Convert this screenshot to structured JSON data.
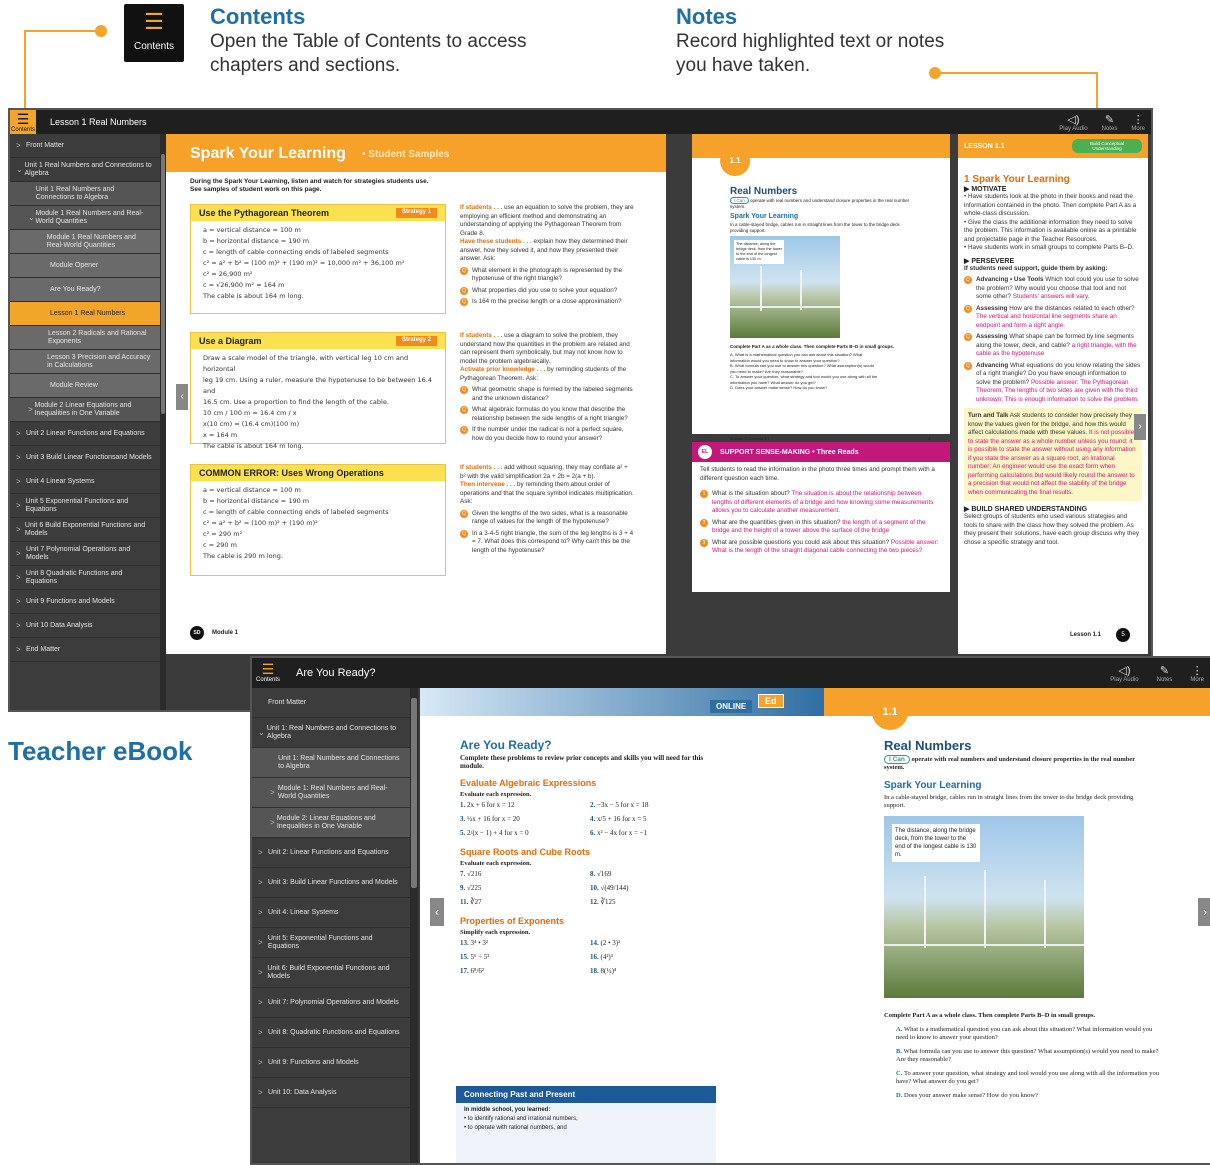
{
  "callouts": {
    "contents": {
      "title": "Contents",
      "text": "Open the Table of Contents to access chapters and sections.",
      "icon_label": "Contents"
    },
    "notes": {
      "title": "Notes",
      "text": "Record highlighted text or notes you have taken."
    },
    "teacher_ebook": "Teacher eBook"
  },
  "colors": {
    "accent": "#f3a52a",
    "callout_blue": "#1d6fa5",
    "sidebar": "#3c3c3c",
    "topbar": "#1f1f1f"
  },
  "teacher": {
    "menu_label": "Contents",
    "title": "Lesson 1 Real Numbers",
    "toolbar": {
      "play": "Play Audio",
      "notes": "Notes",
      "more": "More"
    },
    "sidebar": [
      {
        "label": "Front Matter",
        "level": 0,
        "chev": ">"
      },
      {
        "label": "Unit 1 Real Numbers and Connections to Algebra",
        "level": 0,
        "chev": "v"
      },
      {
        "label": "Unit 1 Real Numbers and Connections to Algebra",
        "level": 1,
        "chev": ""
      },
      {
        "label": "Module 1 Real Numbers and Real-World Quantities",
        "level": 1,
        "chev": "v"
      },
      {
        "label": "Module 1 Real Numbers and Real-World Quantities",
        "level": 2,
        "chev": ""
      },
      {
        "label": "Module Opener",
        "level": 2,
        "chev": ""
      },
      {
        "label": "Are You Ready?",
        "level": 2,
        "chev": ""
      },
      {
        "label": "Lesson 1 Real Numbers",
        "level": 2,
        "chev": "",
        "active": true
      },
      {
        "label": "Lesson 2 Radicals and Rational Exponents",
        "level": 2,
        "chev": ""
      },
      {
        "label": "Lesson 3 Precision and Accuracy in Calculations",
        "level": 2,
        "chev": ""
      },
      {
        "label": "Module Review",
        "level": 2,
        "chev": ""
      },
      {
        "label": "Module 2 Linear Equations and Inequalities in One Variable",
        "level": 1,
        "chev": ">"
      },
      {
        "label": "Unit 2 Linear Functions and Equations",
        "level": 0,
        "chev": ">"
      },
      {
        "label": "Unit 3 Build Linear Functionsand Models",
        "level": 0,
        "chev": ">"
      },
      {
        "label": "Unit 4 Linear Systems",
        "level": 0,
        "chev": ">"
      },
      {
        "label": "Unit 5 Exponential Functions and Equations",
        "level": 0,
        "chev": ">"
      },
      {
        "label": "Unit 6 Build Exponential Functions and Models",
        "level": 0,
        "chev": ">"
      },
      {
        "label": "Unit 7 Polynomial Operations and Models",
        "level": 0,
        "chev": ">"
      },
      {
        "label": "Unit 8 Quadratic Functions and Equations",
        "level": 0,
        "chev": ">"
      },
      {
        "label": "Unit 9 Functions and Models",
        "level": 0,
        "chev": ">"
      },
      {
        "label": "Unit 10 Data Analysis",
        "level": 0,
        "chev": ">"
      },
      {
        "label": "End Matter",
        "level": 0,
        "chev": ">"
      }
    ],
    "left_page": {
      "banner": "Spark Your Learning",
      "banner_sub": "• Student Samples",
      "intro": "During the Spark Your Learning, listen and watch for strategies students use. See samples of student work on this page.",
      "box1": {
        "title": "Use the Pythagorean Theorem",
        "tag": "Strategy 1",
        "lines": [
          "a = vertical distance = 100 m",
          "b = horizontal distance = 190 m",
          "c = length of cable connecting ends of labeled segments",
          "c² = a² + b² = (100 m)² + (190 m)² = 10,000 m² + 36,100 m²",
          "c² = 26,900 m²",
          "c = √26,900 m² ≈ 164 m",
          "The cable is about 164 m long."
        ]
      },
      "box2": {
        "title": "Use a Diagram",
        "tag": "Strategy 2",
        "lines": [
          "Draw a scale model of the triangle, with vertical leg 10 cm and horizontal",
          "leg 19 cm. Using a ruler, measure the hypotenuse to be between 16.4 and",
          "16.5 cm. Use a proportion to find the length of the cable.",
          "10 cm / 100 m = 16.4 cm / x",
          "x(10 cm) = (16.4 cm)(100 m)",
          "x = 164 m",
          "The cable is about 164 m long."
        ]
      },
      "box3": {
        "title": "COMMON ERROR: Uses Wrong Operations",
        "lines": [
          "a = vertical distance = 100 m",
          "b = horizontal distance = 190 m",
          "c = length of cable connecting ends of labeled segments",
          "c² = a² + b² = (100 m)² + (190 m)²",
          "c² = 290 m²",
          "c = 290 m",
          "The cable is 290 m long."
        ]
      },
      "note1": {
        "lead": "If students . . .",
        "text": "use an equation to solve the problem, they are employing an efficient method and demonstrating an understanding of applying the Pythagorean Theorem from Grade 8.",
        "lead2": "Have these students . . .",
        "text2": "explain how they determined their answer, how they solved it, and how they presented their answer. Ask:",
        "qs": [
          "What element in the photograph is represented by the hypotenuse of the right triangle?",
          "What properties did you use to solve your equation?",
          "Is 164 m the precise length or a close approximation?"
        ]
      },
      "note2": {
        "lead": "If students . . .",
        "text": "use a diagram to solve the problem, they understand how the quantities in the problem are related and can represent them symbolically, but may not know how to model the problem algebraically.",
        "lead2": "Activate prior knowledge . . .",
        "text2": "by reminding students of the Pythagorean Theorem. Ask:",
        "qs": [
          "What geometric shape is formed by the labeled segments and the unknown distance?",
          "What algebraic formulas do you know that describe the relationship between the side lengths of a right triangle?",
          "If the number under the radical is not a perfect square, how do you decide how to round your answer?"
        ]
      },
      "note3": {
        "lead": "If students . . .",
        "text": "add without squaring, they may conflate a² + b² with the valid simplification 2a + 2b = 2(a + b).",
        "lead2": "Then intervene . . .",
        "text2": "by reminding them about order of operations and that the square symbol indicates multiplication. Ask:",
        "qs": [
          "Given the lengths of the two sides, what is a reasonable range of values for the length of the hypotenuse?",
          "In a 3-4-5 right triangle, the sum of the leg lengths is 3 + 4 = 7. What does this correspond to? Why can't this be the length of the hypotenuse?"
        ]
      },
      "footer_badge": "SD",
      "footer": "Module 1"
    },
    "right_page": {
      "tab": "1.1",
      "title": "Real Numbers",
      "ican": "I Can",
      "ican_text": "operate with real numbers and understand closure properties in the real number system.",
      "spark": "Spark Your Learning",
      "spark_text": "In a cable-stayed bridge, cables run in straight lines from the tower to the bridge deck providing support.",
      "photo_caption": "The distance, along the bridge deck, from the tower to the end of the longest cable is 130 m.",
      "parts_head": "Complete Part A as a whole class. Then complete Parts B–D in small groups.",
      "parts": [
        "What is a mathematical question you can ask about this situation? What information would you need to know to answer your question?",
        "What formula can you use to answer this question? What assumption(s) would you need to make? Are they reasonable?",
        "To answer your question, what strategy and tool would you use along with all the information you have? What answer do you get?",
        "Does your answer make sense? How do you know?"
      ],
      "footer": "Module 1 • Lesson 1.1",
      "page": "3"
    },
    "support": {
      "badge": "EL",
      "title": "SUPPORT SENSE-MAKING • Three Reads",
      "intro": "Tell students to read the information in the photo three times and prompt them with a different question each time.",
      "items": [
        {
          "q": "What is the situation about?",
          "a": "The situation is about the relationship between lengths of different elements of a bridge and how knowing some measurements allows you to calculate another measurement."
        },
        {
          "q": "What are the quantities given in this situation?",
          "a": "the length of a segment of the bridge and the height of a tower above the surface of the bridge"
        },
        {
          "q": "What are possible questions you could ask about this situation?",
          "a": "Possible answer: What is the length of the straight diagonal cable connecting the two pieces?"
        }
      ]
    },
    "lesson": {
      "tag": "LESSON 1.1",
      "badge": "Build Conceptual Understanding",
      "heading": "1  Spark Your Learning",
      "motivate": "MOTIVATE",
      "motivate_items": [
        "Have students look at the photo in their books and read the information contained in the photo. Then complete Part A as a whole-class discussion.",
        "Give the class the additional information they need to solve the problem. This information is available online as a printable and projectable page in the Teacher Resources.",
        "Have students work in small groups to complete Parts B–D."
      ],
      "persevere": "PERSEVERE",
      "persevere_intro": "If students need support, guide them by asking:",
      "persevere_items": [
        {
          "k": "Advancing • Use Tools",
          "t": "Which tool could you use to solve the problem? Why would you choose that tool and not some other?",
          "a": "Students' answers will vary."
        },
        {
          "k": "Assessing",
          "t": "How are the distances related to each other?",
          "a": "The vertical and horizontal line segments share an endpoint and form a right angle."
        },
        {
          "k": "Assessing",
          "t": "What shape can be formed by line segments along the tower, deck, and cable?",
          "a": "a right triangle, with the cable as the hypotenuse"
        },
        {
          "k": "Advancing",
          "t": "What equations do you know relating the sides of a right triangle? Do you have enough information to solve the problem?",
          "a": "Possible answer: The Pythagorean Theorem; The lengths of two sides are given with the third unknown; This is enough information to solve the problem."
        }
      ],
      "turn_talk": "Turn and Talk",
      "turn_text": "Ask students to consider how precisely they know the values given for the bridge, and how this would affect calculations made with these values.",
      "turn_ans": "It is not possible to state the answer as a whole number unless you round; it is possible to state the answer without using any information if you state the answer as a square root, an irrational number; An engineer would use the exact form when performing calculations but would likely round the answer to a precision that would not affect the stability of the bridge when communicating the final results.",
      "build": "BUILD SHARED UNDERSTANDING",
      "build_text": "Select groups of students who used various strategies and tools to share with the class how they solved the problem. As they present their solutions, have each group discuss why they chose a specific strategy and tool.",
      "footer": "Lesson 1.1",
      "page": "5"
    }
  },
  "student": {
    "menu_label": "Contents",
    "title": "Are You Ready?",
    "toolbar": {
      "play": "Play Audio",
      "notes": "Notes",
      "more": "More"
    },
    "sidebar": [
      {
        "label": "Front Matter",
        "level": 0,
        "chev": ""
      },
      {
        "label": "Unit 1: Real Numbers and Connections to Algebra",
        "level": 0,
        "chev": "v"
      },
      {
        "label": "Unit 1: Real Numbers and Connections to Algebra",
        "level": 1,
        "chev": ""
      },
      {
        "label": "Module 1: Real Numbers and Real-World Quantities",
        "level": 1,
        "chev": ">"
      },
      {
        "label": "Module 2: Linear Equations and Inequalities in One Variable",
        "level": 1,
        "chev": ">"
      },
      {
        "label": "Unit 2: Linear Functions and Equations",
        "level": 0,
        "chev": ">"
      },
      {
        "label": "Unit 3: Build Linear Functions and Models",
        "level": 0,
        "chev": ">"
      },
      {
        "label": "Unit 4: Linear Systems",
        "level": 0,
        "chev": ">"
      },
      {
        "label": "Unit 5: Exponential Functions and Equations",
        "level": 0,
        "chev": ">"
      },
      {
        "label": "Unit 6: Build Exponential Functions and Models",
        "level": 0,
        "chev": ">"
      },
      {
        "label": "Unit 7: Polynomial Operations and Models",
        "level": 0,
        "chev": ">"
      },
      {
        "label": "Unit 8: Quadratic Functions and Equations",
        "level": 0,
        "chev": ">"
      },
      {
        "label": "Unit 9: Functions and Models",
        "level": 0,
        "chev": ">"
      },
      {
        "label": "Unit 10: Data Analysis",
        "level": 0,
        "chev": ">"
      }
    ],
    "left_page": {
      "online": "ONLINE",
      "ed": "Ed",
      "title": "Are You Ready?",
      "intro": "Complete these problems to review prior concepts and skills you will need for this module.",
      "sections": [
        {
          "head": "Evaluate Algebraic Expressions",
          "sub": "Evaluate each expression.",
          "items": [
            [
              "1.",
              "2x + 6 for x = 12"
            ],
            [
              "2.",
              "−3x − 5 for x = 18"
            ],
            [
              "3.",
              "½x + 16 for x = 20"
            ],
            [
              "4.",
              "x/5 + 16 for x = 5"
            ],
            [
              "5.",
              "2/(x − 1) + 4 for x = 0"
            ],
            [
              "6.",
              "x² − 4x for x = −1"
            ]
          ]
        },
        {
          "head": "Square Roots and Cube Roots",
          "sub": "Evaluate each expression.",
          "items": [
            [
              "7.",
              "√216"
            ],
            [
              "8.",
              "√169"
            ],
            [
              "9.",
              "√225"
            ],
            [
              "10.",
              "√(49/144)"
            ],
            [
              "11.",
              "∛27"
            ],
            [
              "12.",
              "∛125"
            ]
          ]
        },
        {
          "head": "Properties of Exponents",
          "sub": "Simplify each expression.",
          "items": [
            [
              "13.",
              "3⁴ • 3²"
            ],
            [
              "14.",
              "(2 • 3)²"
            ],
            [
              "15.",
              "5⁶ ÷ 5³"
            ],
            [
              "16.",
              "(4²)³"
            ],
            [
              "17.",
              "6⁸/6²"
            ],
            [
              "18.",
              "8(½)⁴"
            ]
          ]
        }
      ],
      "past": {
        "title": "Connecting Past and Present",
        "sub": "In middle school, you learned:",
        "items": [
          "to identify rational and irrational numbers,",
          "to operate with rational numbers, and"
        ]
      }
    },
    "right_page": {
      "tab": "1.1",
      "title": "Real Numbers",
      "ican": "I Can",
      "ican_text": "operate with real numbers and understand closure properties in the real number system.",
      "spark": "Spark Your Learning",
      "spark_text": "In a cable-stayed bridge, cables run in straight lines from the tower to the bridge deck providing support.",
      "photo_caption": "The distance, along the bridge deck, from the tower to the end of the longest cable is 130 m.",
      "parts_head": "Complete Part A as a whole class. Then complete Parts B–D in small groups.",
      "parts": [
        [
          "A.",
          "What is a mathematical question you can ask about this situation? What information would you need to know to answer your question?"
        ],
        [
          "B.",
          "What formula can you use to answer this question? What assumption(s) would you need to make? Are they reasonable?"
        ],
        [
          "C.",
          "To answer your question, what strategy and tool would you use along with all the information you have? What answer do you get?"
        ],
        [
          "D.",
          "Does your answer make sense? How do you know?"
        ]
      ]
    }
  }
}
